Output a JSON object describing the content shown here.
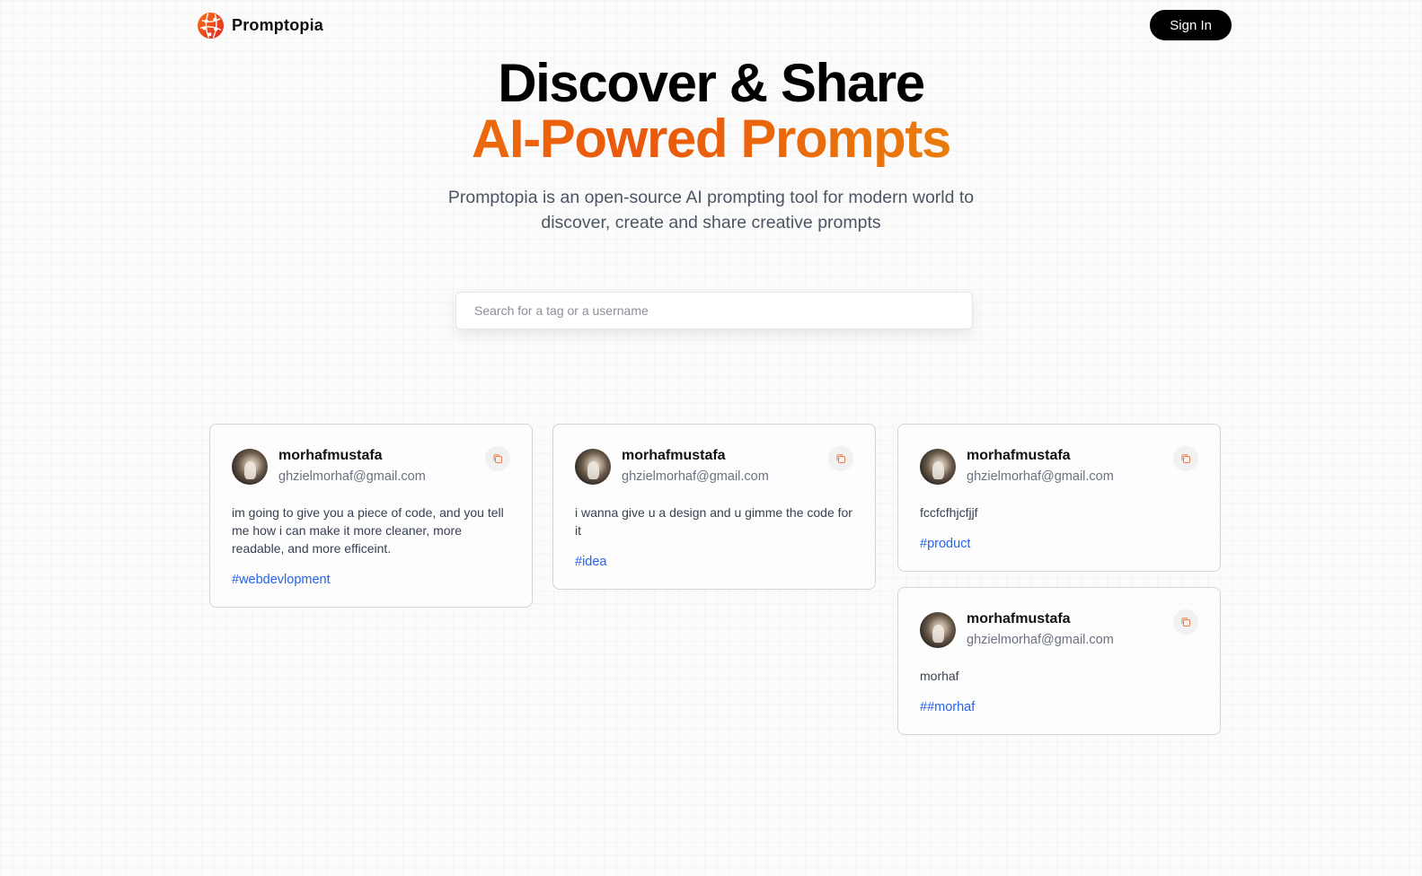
{
  "nav": {
    "brand_name": "Promptopia",
    "sign_in_label": "Sign In"
  },
  "hero": {
    "title_line1": "Discover & Share",
    "title_line2": "AI-Powred Prompts",
    "description": "Promptopia is an open-source AI prompting tool for modern world to discover, create and share creative prompts"
  },
  "search": {
    "placeholder": "Search for a tag or a username",
    "value": ""
  },
  "cards": [
    {
      "username": "morhafmustafa",
      "email": "ghzielmorhaf@gmail.com",
      "prompt": "im going to give you a piece of code, and you tell me how i can make it more cleaner, more readable, and more efficeint.",
      "tag": "#webdevlopment"
    },
    {
      "username": "morhafmustafa",
      "email": "ghzielmorhaf@gmail.com",
      "prompt": "i wanna give u a design and u gimme the code for it",
      "tag": "#idea"
    },
    {
      "username": "morhafmustafa",
      "email": "ghzielmorhaf@gmail.com",
      "prompt": "fccfcfhjcfjjf",
      "tag": "#product"
    },
    {
      "username": "morhafmustafa",
      "email": "ghzielmorhaf@gmail.com",
      "prompt": "morhaf",
      "tag": "##morhaf"
    }
  ],
  "icons": {
    "brand": "globe-logo-icon",
    "copy": "copy-icon"
  },
  "colors": {
    "accent_orange": "#ea580c",
    "accent_amber": "#f59e0b",
    "tag_blue": "#2563eb",
    "button_black": "#000000"
  }
}
